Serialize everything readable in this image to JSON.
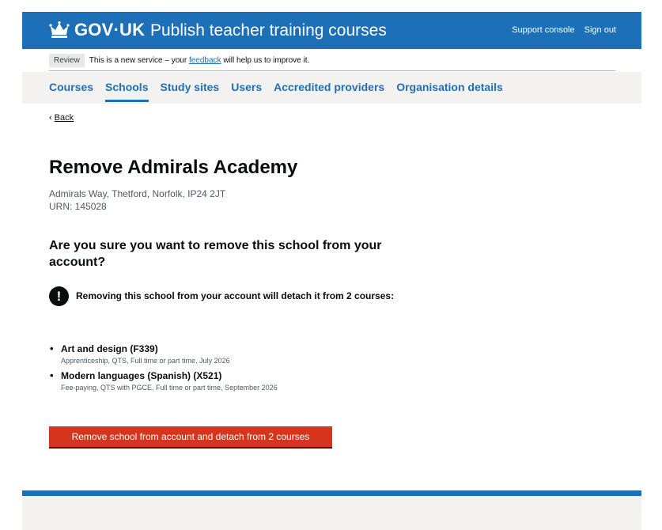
{
  "header": {
    "logo_text": "GOV·UK",
    "service_name": "Publish teacher training courses",
    "links": [
      "Support console",
      "Sign out"
    ]
  },
  "phase_banner": {
    "tag": "Review",
    "text_before": "This is a new service – your",
    "link_text": "feedback",
    "text_after": "will help us to improve it."
  },
  "nav": {
    "items": [
      "Courses",
      "Schools",
      "Study sites",
      "Users",
      "Accredited providers",
      "Organisation details"
    ],
    "active": "Schools"
  },
  "back": {
    "label": "Back"
  },
  "main": {
    "title": "Remove Admirals Academy",
    "address": "Admirals Way, Thetford, Norfolk, IP24 2JT",
    "urn": "URN: 145028",
    "question": "Are you sure you want to remove this school from your account?",
    "warning_icon": "!",
    "warning_text": "Removing this school from your account will detach it from 2 courses:",
    "courses": [
      {
        "title": "Art and design (F339)",
        "meta": "Apprenticeship, QTS, Full time or part time, July 2026"
      },
      {
        "title": "Modern languages (Spanish) (X521)",
        "meta": "Fee-paying, QTS with PGCE, Full time or part time, September 2026"
      }
    ],
    "button_label": "Remove school from account and detach from 2 courses"
  },
  "colors": {
    "brand_blue": "#1d70b8",
    "warning_red": "#d4351c",
    "nav_background": "#f3f2f1"
  },
  "icons": [
    "crown-icon",
    "warning-icon",
    "chevron-left-icon"
  ]
}
